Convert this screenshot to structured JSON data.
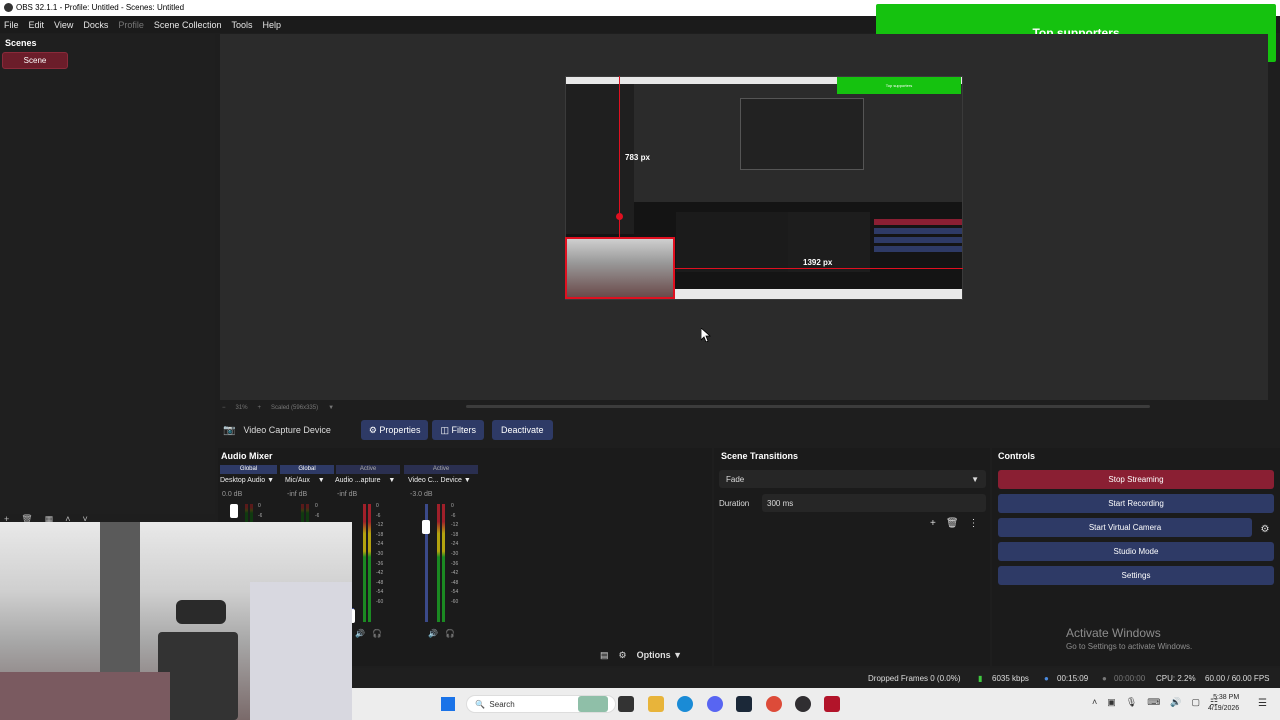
{
  "window": {
    "title": "OBS 32.1.1 - Profile: Untitled - Scenes: Untitled"
  },
  "menu": [
    "File",
    "Edit",
    "View",
    "Docks",
    "Profile",
    "Scene Collection",
    "Tools",
    "Help"
  ],
  "overlay": {
    "supporters": "Top supporters"
  },
  "scenes": {
    "title": "Scenes",
    "items": [
      "Scene"
    ]
  },
  "preview": {
    "height_label": "783 px",
    "width_label": "1392 px",
    "zoom": "31%",
    "scaled": "Scaled (596x335)"
  },
  "source_bar": {
    "source_name": "Video Capture Device",
    "properties": "Properties",
    "filters": "Filters",
    "deactivate": "Deactivate"
  },
  "mixer": {
    "title": "Audio Mixer",
    "channels": [
      {
        "head": "Global",
        "name": "Desktop Audio",
        "db": "0.0 dB",
        "active": true
      },
      {
        "head": "Global",
        "name": "Mic/Aux",
        "db": "-inf dB",
        "active": false
      },
      {
        "head": "Active",
        "name": "Audio ...apture",
        "db": "-inf dB",
        "active": true
      },
      {
        "head": "Active",
        "name": "Video C... Device",
        "db": "-3.0 dB",
        "active": true
      }
    ],
    "ticks": [
      "0",
      "-6",
      "-12",
      "-18",
      "-24",
      "-30",
      "-36",
      "-42",
      "-48",
      "-54",
      "-60"
    ],
    "options": "Options"
  },
  "transitions": {
    "title": "Scene Transitions",
    "selected": "Fade",
    "duration_label": "Duration",
    "duration_value": "300 ms"
  },
  "controls": {
    "title": "Controls",
    "stop_streaming": "Stop Streaming",
    "start_recording": "Start Recording",
    "start_virtual_camera": "Start Virtual Camera",
    "studio_mode": "Studio Mode",
    "settings": "Settings"
  },
  "activate": {
    "line1": "Activate Windows",
    "line2": "Go to Settings to activate Windows."
  },
  "status": {
    "dropped": "Dropped Frames 0 (0.0%)",
    "bitrate": "6035 kbps",
    "stream_time": "00:15:09",
    "rec_time": "00:00:00",
    "cpu": "CPU: 2.2%",
    "fps": "60.00 / 60.00 FPS"
  },
  "taskbar": {
    "search": "Search",
    "time": "5:38 PM",
    "date": "4/19/2026"
  },
  "colors": {
    "stream_active": "#8a1f33",
    "button": "#2e3a66",
    "overlay_green": "#15c20f",
    "guide_red": "#e01020"
  }
}
